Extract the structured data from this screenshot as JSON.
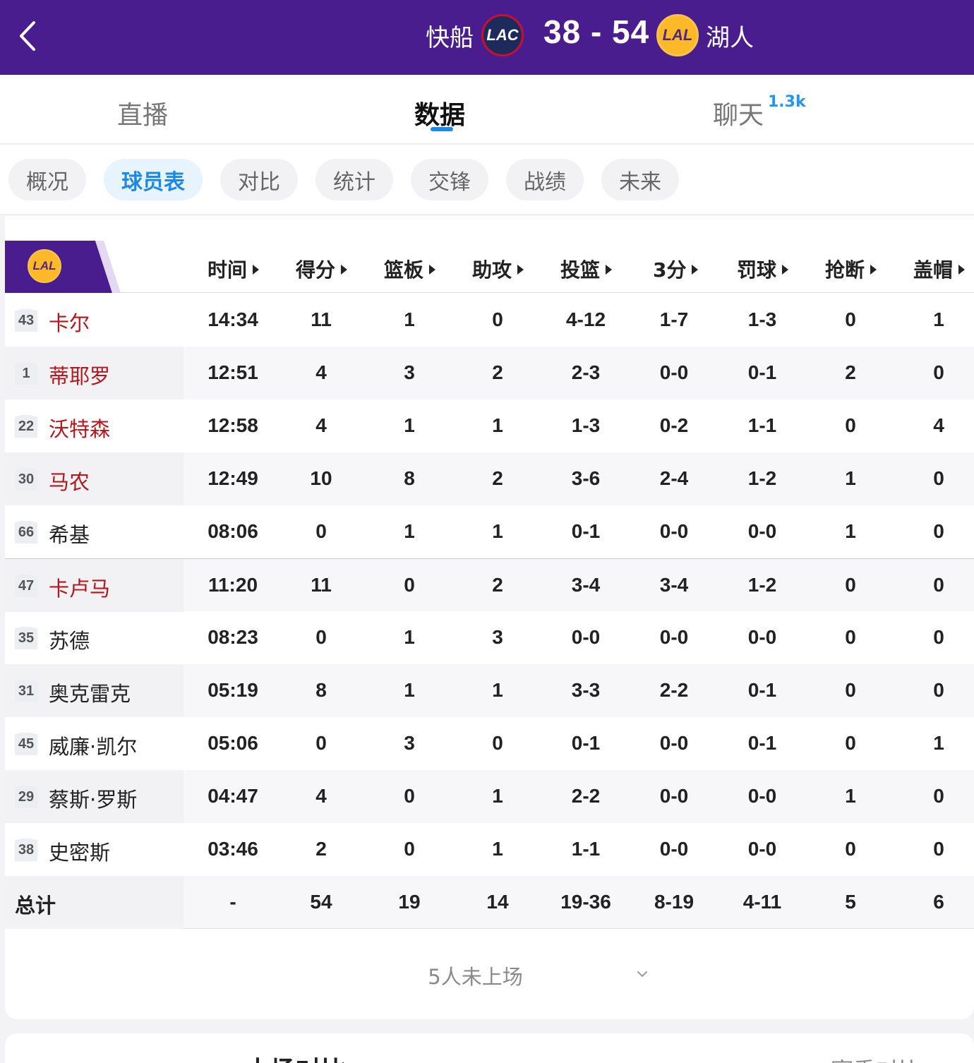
{
  "header": {
    "home_team": "快船",
    "home_logo": "LAC",
    "score": "38 - 54",
    "away_logo": "LAL",
    "away_team": "湖人"
  },
  "main_tabs": [
    {
      "label": "直播"
    },
    {
      "label": "数据"
    },
    {
      "label": "聊天",
      "badge": "1.3k"
    }
  ],
  "sub_tabs": [
    "概况",
    "球员表",
    "对比",
    "统计",
    "交锋",
    "战绩",
    "未来"
  ],
  "table": {
    "team_logo": "LAL",
    "columns": [
      "时间",
      "得分",
      "篮板",
      "助攻",
      "投篮",
      "3分",
      "罚球",
      "抢断",
      "盖帽"
    ],
    "players": [
      {
        "num": "43",
        "name": "卡尔",
        "starter": true,
        "stats": [
          "14:34",
          "11",
          "1",
          "0",
          "4-12",
          "1-7",
          "1-3",
          "0",
          "1"
        ]
      },
      {
        "num": "1",
        "name": "蒂耶罗",
        "starter": true,
        "stats": [
          "12:51",
          "4",
          "3",
          "2",
          "2-3",
          "0-0",
          "0-1",
          "2",
          "0"
        ]
      },
      {
        "num": "22",
        "name": "沃特森",
        "starter": true,
        "stats": [
          "12:58",
          "4",
          "1",
          "1",
          "1-3",
          "0-2",
          "1-1",
          "0",
          "4"
        ]
      },
      {
        "num": "30",
        "name": "马农",
        "starter": true,
        "stats": [
          "12:49",
          "10",
          "8",
          "2",
          "3-6",
          "2-4",
          "1-2",
          "1",
          "0"
        ]
      },
      {
        "num": "66",
        "name": "希基",
        "starter": false,
        "stats": [
          "08:06",
          "0",
          "1",
          "1",
          "0-1",
          "0-0",
          "0-0",
          "1",
          "0"
        ]
      },
      {
        "num": "47",
        "name": "卡卢马",
        "starter": true,
        "stats": [
          "11:20",
          "11",
          "0",
          "2",
          "3-4",
          "3-4",
          "1-2",
          "0",
          "0"
        ]
      },
      {
        "num": "35",
        "name": "苏德",
        "starter": false,
        "stats": [
          "08:23",
          "0",
          "1",
          "3",
          "0-0",
          "0-0",
          "0-0",
          "0",
          "0"
        ]
      },
      {
        "num": "31",
        "name": "奥克雷克",
        "starter": false,
        "stats": [
          "05:19",
          "8",
          "1",
          "1",
          "3-3",
          "2-2",
          "0-1",
          "0",
          "0"
        ]
      },
      {
        "num": "45",
        "name": "威廉·凯尔",
        "starter": false,
        "stats": [
          "05:06",
          "0",
          "3",
          "0",
          "0-1",
          "0-0",
          "0-1",
          "0",
          "1"
        ]
      },
      {
        "num": "29",
        "name": "蔡斯·罗斯",
        "starter": false,
        "stats": [
          "04:47",
          "4",
          "0",
          "1",
          "2-2",
          "0-0",
          "0-0",
          "1",
          "0"
        ]
      },
      {
        "num": "38",
        "name": "史密斯",
        "starter": false,
        "stats": [
          "03:46",
          "2",
          "0",
          "1",
          "1-1",
          "0-0",
          "0-0",
          "0",
          "0"
        ]
      }
    ],
    "total": {
      "label": "总计",
      "stats": [
        "-",
        "54",
        "19",
        "14",
        "19-36",
        "8-19",
        "4-11",
        "5",
        "6"
      ]
    }
  },
  "unplayed": "5人未上场",
  "bottom": {
    "left": "本场对比",
    "right": "赛季对比"
  },
  "colors": {
    "header_bg": "#4a1d8e",
    "accent": "#1e88e5",
    "starter": "#b4161b",
    "lakers_purple": "#552583",
    "lakers_gold": "#fdb927"
  }
}
